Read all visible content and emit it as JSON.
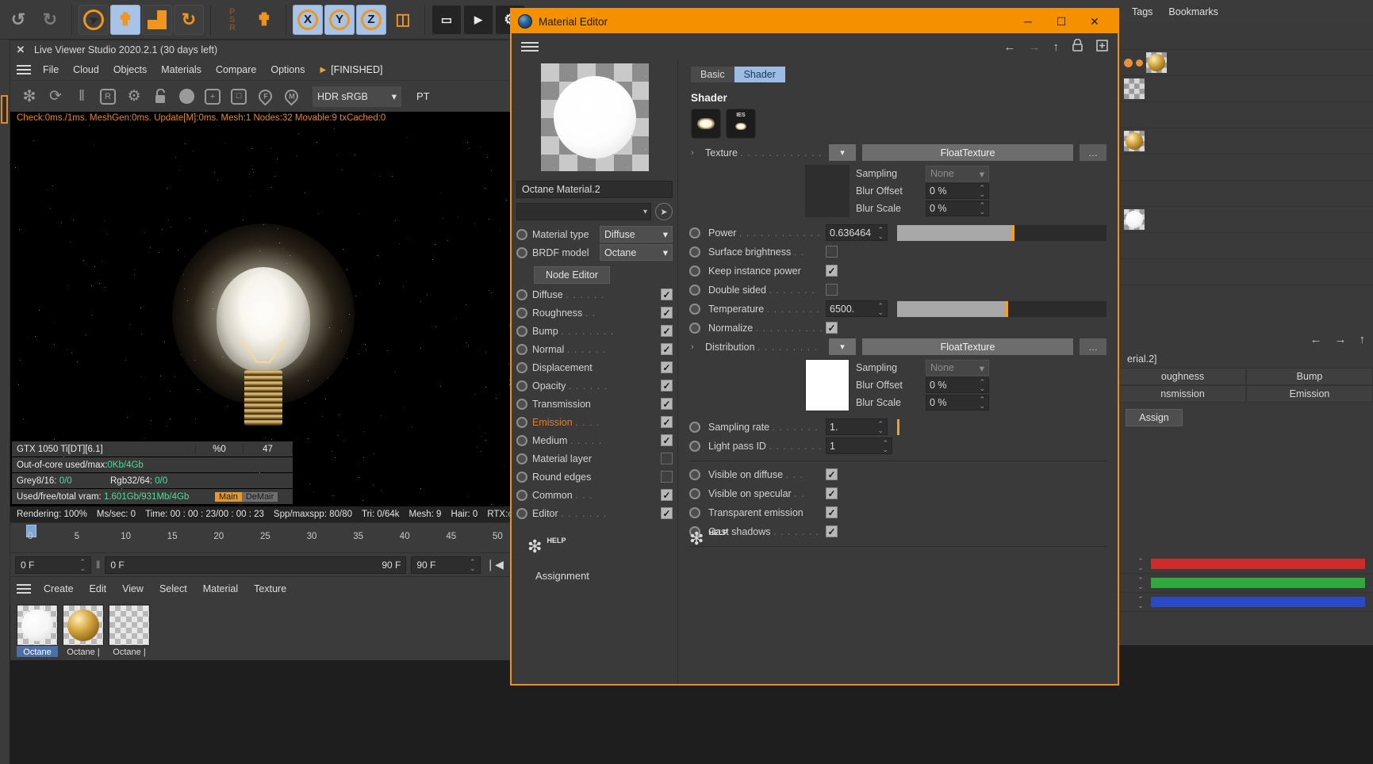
{
  "c4d_toolbar": {
    "buttons": [
      {
        "name": "undo-button",
        "glyph": "↶"
      },
      {
        "name": "redo-button",
        "glyph": "↷"
      },
      {
        "name": "select-tool-button",
        "glyph": "➤"
      },
      {
        "name": "move-tool-button",
        "glyph": "✥"
      },
      {
        "name": "scale-tool-button",
        "glyph": "◢"
      },
      {
        "name": "rotate-tool-button",
        "glyph": "↻"
      },
      {
        "name": "psr-tool-button",
        "glyph": "PSR"
      },
      {
        "name": "world-axis-button",
        "glyph": "✥"
      }
    ],
    "axes": [
      "X",
      "Y",
      "Z"
    ],
    "extra": [
      {
        "name": "coordinate-system-button",
        "glyph": "⬚"
      },
      {
        "name": "render-view-button",
        "glyph": "▭"
      },
      {
        "name": "render-to-picture-viewer-button",
        "glyph": "▶"
      },
      {
        "name": "render-settings-button",
        "glyph": "⚙"
      }
    ]
  },
  "live_viewer": {
    "title": "Live Viewer Studio 2020.2.1 (30 days left)",
    "close_glyph": "✕",
    "menu": [
      "File",
      "Cloud",
      "Objects",
      "Materials",
      "Compare",
      "Options"
    ],
    "arrow_glyph": "▶",
    "status_tag": "[FINISHED]",
    "toolbar_icons": [
      {
        "name": "octane-restart-icon",
        "glyph": "❇"
      },
      {
        "name": "refresh-icon",
        "glyph": "⟳"
      },
      {
        "name": "pause-icon",
        "glyph": "‖"
      },
      {
        "name": "region-render-icon",
        "glyph": "R"
      },
      {
        "name": "settings-gear-icon",
        "glyph": "⚙"
      },
      {
        "name": "lock-icon",
        "glyph": "🔒"
      },
      {
        "name": "material-preview-icon",
        "glyph": "●"
      },
      {
        "name": "add-icon",
        "glyph": "+"
      },
      {
        "name": "object-icon",
        "glyph": "□"
      },
      {
        "name": "focus-pin-icon",
        "glyph": "F"
      },
      {
        "name": "material-pin-icon",
        "glyph": "M"
      }
    ],
    "color_profile": "HDR sRGB",
    "chevron": "▾",
    "kernel": "PT",
    "status_line": "Check:0ms./1ms.  MeshGen:0ms.  Update[M]:0ms.  Mesh:1  Nodes:32  Movable:9  txCached:0",
    "stats": {
      "gpu": "GTX 1050 Ti[DT][6.1]",
      "gpu_usage": "%0",
      "gpu_temp": "47",
      "oocore_label": "Out-of-core used/max:",
      "oocore_value": "0Kb/4Gb",
      "grey_label": "Grey8/16:",
      "grey_value": "0/0",
      "rgb_label": "Rgb32/64:",
      "rgb_value": "0/0",
      "vram_label": "Used/free/total vram:",
      "vram_value": "1.601Gb/931Mb/4Gb",
      "badge_main": "Main",
      "badge_demair": "DeMair"
    },
    "render_line": {
      "rendering": "Rendering: 100%",
      "msec": "Ms/sec: 0",
      "time": "Time: 00 : 00 : 23/00 : 00 : 23",
      "spp": "Spp/maxspp: 80/80",
      "tri": "Tri: 0/64k",
      "mesh": "Mesh: 9",
      "hair": "Hair: 0",
      "rtx_label": "RTX:",
      "rtx_value": "off"
    },
    "timeline": {
      "ticks": [
        "0",
        "5",
        "10",
        "15",
        "20",
        "25",
        "30",
        "35",
        "40",
        "45",
        "50"
      ],
      "jump_start_glyph": "❘◀"
    },
    "frame_fields": {
      "current": "0 F",
      "start": "0 F",
      "preview_end": "90 F",
      "end": "90 F"
    },
    "material_menu": [
      "Create",
      "Edit",
      "View",
      "Select",
      "Material",
      "Texture"
    ],
    "materials": [
      {
        "name": "Octane",
        "kind": "white",
        "selected": true
      },
      {
        "name": "Octane |",
        "kind": "gold",
        "selected": false
      },
      {
        "name": "Octane |",
        "kind": "checker",
        "selected": false
      }
    ]
  },
  "material_editor": {
    "title": "Material Editor",
    "window_buttons": {
      "minimize": "─",
      "maximize": "☐",
      "close": "✕"
    },
    "hamburger": "menu-icon",
    "nav_icons": {
      "back": "←",
      "forward": "→",
      "up": "↑",
      "lock": "🔒",
      "add": "⊞"
    },
    "left": {
      "material_name": "Octane Material.2",
      "picker_glyph": "➤",
      "material_type_label": "Material type",
      "material_type_value": "Diffuse",
      "brdf_label": "BRDF model",
      "brdf_value": "Octane",
      "node_editor_button": "Node Editor",
      "channels": [
        {
          "label": "Diffuse",
          "dots": ". . . . . .",
          "checked": true,
          "active": false
        },
        {
          "label": "Roughness",
          "dots": ". .",
          "checked": true,
          "active": false
        },
        {
          "label": "Bump",
          "dots": ". . . . . . . .",
          "checked": true,
          "active": false
        },
        {
          "label": "Normal",
          "dots": ". . . . . .",
          "checked": true,
          "active": false
        },
        {
          "label": "Displacement",
          "dots": "",
          "checked": true,
          "active": false
        },
        {
          "label": "Opacity",
          "dots": ". . . . . .",
          "checked": true,
          "active": false
        },
        {
          "label": "Transmission",
          "dots": "",
          "checked": true,
          "active": false
        },
        {
          "label": "Emission",
          "dots": ". . . .",
          "checked": true,
          "active": true
        },
        {
          "label": "Medium",
          "dots": ". . . . .",
          "checked": true,
          "active": false
        },
        {
          "label": "Material layer",
          "dots": "",
          "checked": false,
          "active": false
        },
        {
          "label": "Round edges",
          "dots": "",
          "checked": false,
          "active": false
        },
        {
          "label": "Common",
          "dots": ". . .",
          "checked": true,
          "active": false
        },
        {
          "label": "Editor",
          "dots": ". . . . . . .",
          "checked": true,
          "active": false
        }
      ],
      "help_label": "HELP",
      "help_glyph": "❇",
      "assignment_label": "Assignment"
    },
    "right": {
      "tabs": [
        {
          "label": "Basic",
          "active": false
        },
        {
          "label": "Shader",
          "active": true
        }
      ],
      "section_title": "Shader",
      "shader_icons": [
        {
          "name": "blackbody-emission-icon",
          "badge": ""
        },
        {
          "name": "ies-emission-icon",
          "badge": "IES"
        }
      ],
      "texture_row": {
        "label": "Texture",
        "dots": ". . . . . . . . . . . .",
        "chevron": "▾",
        "expand": "›",
        "value": "FloatTexture",
        "dots_button": "…",
        "swatch": "dark",
        "sampling_label": "Sampling",
        "sampling_value": "None",
        "blur_offset_label": "Blur Offset",
        "blur_offset_value": "0 %",
        "blur_scale_label": "Blur Scale",
        "blur_scale_value": "0 %"
      },
      "power": {
        "label": "Power",
        "dots": ". . . . . . . . . . . .",
        "value": "0.636464",
        "slider_percent": 55
      },
      "toggles_a": [
        {
          "label": "Surface brightness",
          "dots": ". .",
          "checked": false
        },
        {
          "label": "Keep instance power",
          "dots": "",
          "checked": true
        },
        {
          "label": "Double sided",
          "dots": ". . . . . . .",
          "checked": false
        }
      ],
      "temperature": {
        "label": "Temperature",
        "dots": ". . . . . . . .",
        "value": "6500.",
        "slider_percent": 52
      },
      "normalize": {
        "label": "Normalize",
        "dots": ". . . . . . . . . . .",
        "checked": true
      },
      "distribution_row": {
        "label": "Distribution",
        "dots": ". . . . . . . . .",
        "chevron": "▾",
        "expand": "›",
        "value": "FloatTexture",
        "dots_button": "…",
        "swatch": "white",
        "sampling_label": "Sampling",
        "sampling_value": "None",
        "blur_offset_label": "Blur Offset",
        "blur_offset_value": "0 %",
        "blur_scale_label": "Blur Scale",
        "blur_scale_value": "0 %"
      },
      "sampling_rate": {
        "label": "Sampling rate",
        "dots": ". . . . . . .",
        "value": "1.",
        "slider_percent": 0
      },
      "light_pass_id": {
        "label": "Light pass ID",
        "dots": ". . . . . . . .",
        "value": "1"
      },
      "visibility": [
        {
          "label": "Visible on diffuse",
          "dots": ". . .",
          "checked": true
        },
        {
          "label": "Visible on specular",
          "dots": ". .",
          "checked": true
        },
        {
          "label": "Transparent emission",
          "dots": "",
          "checked": true
        },
        {
          "label": "Cast shadows",
          "dots": ". . . . . . .",
          "checked": true
        }
      ],
      "help_label": "HELP",
      "help_glyph": "❇"
    }
  },
  "right_panels": {
    "menu": [
      "Tags",
      "Bookmarks"
    ],
    "object_rows": [
      {
        "kind": "empty"
      },
      {
        "kind": "dots_gold"
      },
      {
        "kind": "checker"
      },
      {
        "kind": "empty"
      },
      {
        "kind": "gold"
      },
      {
        "kind": "empty"
      },
      {
        "kind": "empty"
      },
      {
        "kind": "white"
      },
      {
        "kind": "empty"
      },
      {
        "kind": "empty"
      }
    ],
    "attributes": {
      "nav": {
        "back": "←",
        "forward": "→",
        "up": "↑"
      },
      "title": "erial.2]",
      "tabs": [
        "oughness",
        "Bump",
        "nsmission",
        "Emission"
      ],
      "assign_button": "Assign"
    },
    "color_rows": [
      {
        "name": "red-channel-bar",
        "color": "#cf2b2b"
      },
      {
        "name": "green-channel-bar",
        "color": "#2fa83c"
      },
      {
        "name": "blue-channel-bar",
        "color": "#2a49c6"
      }
    ],
    "spin_glyph": "⌃⌄"
  }
}
